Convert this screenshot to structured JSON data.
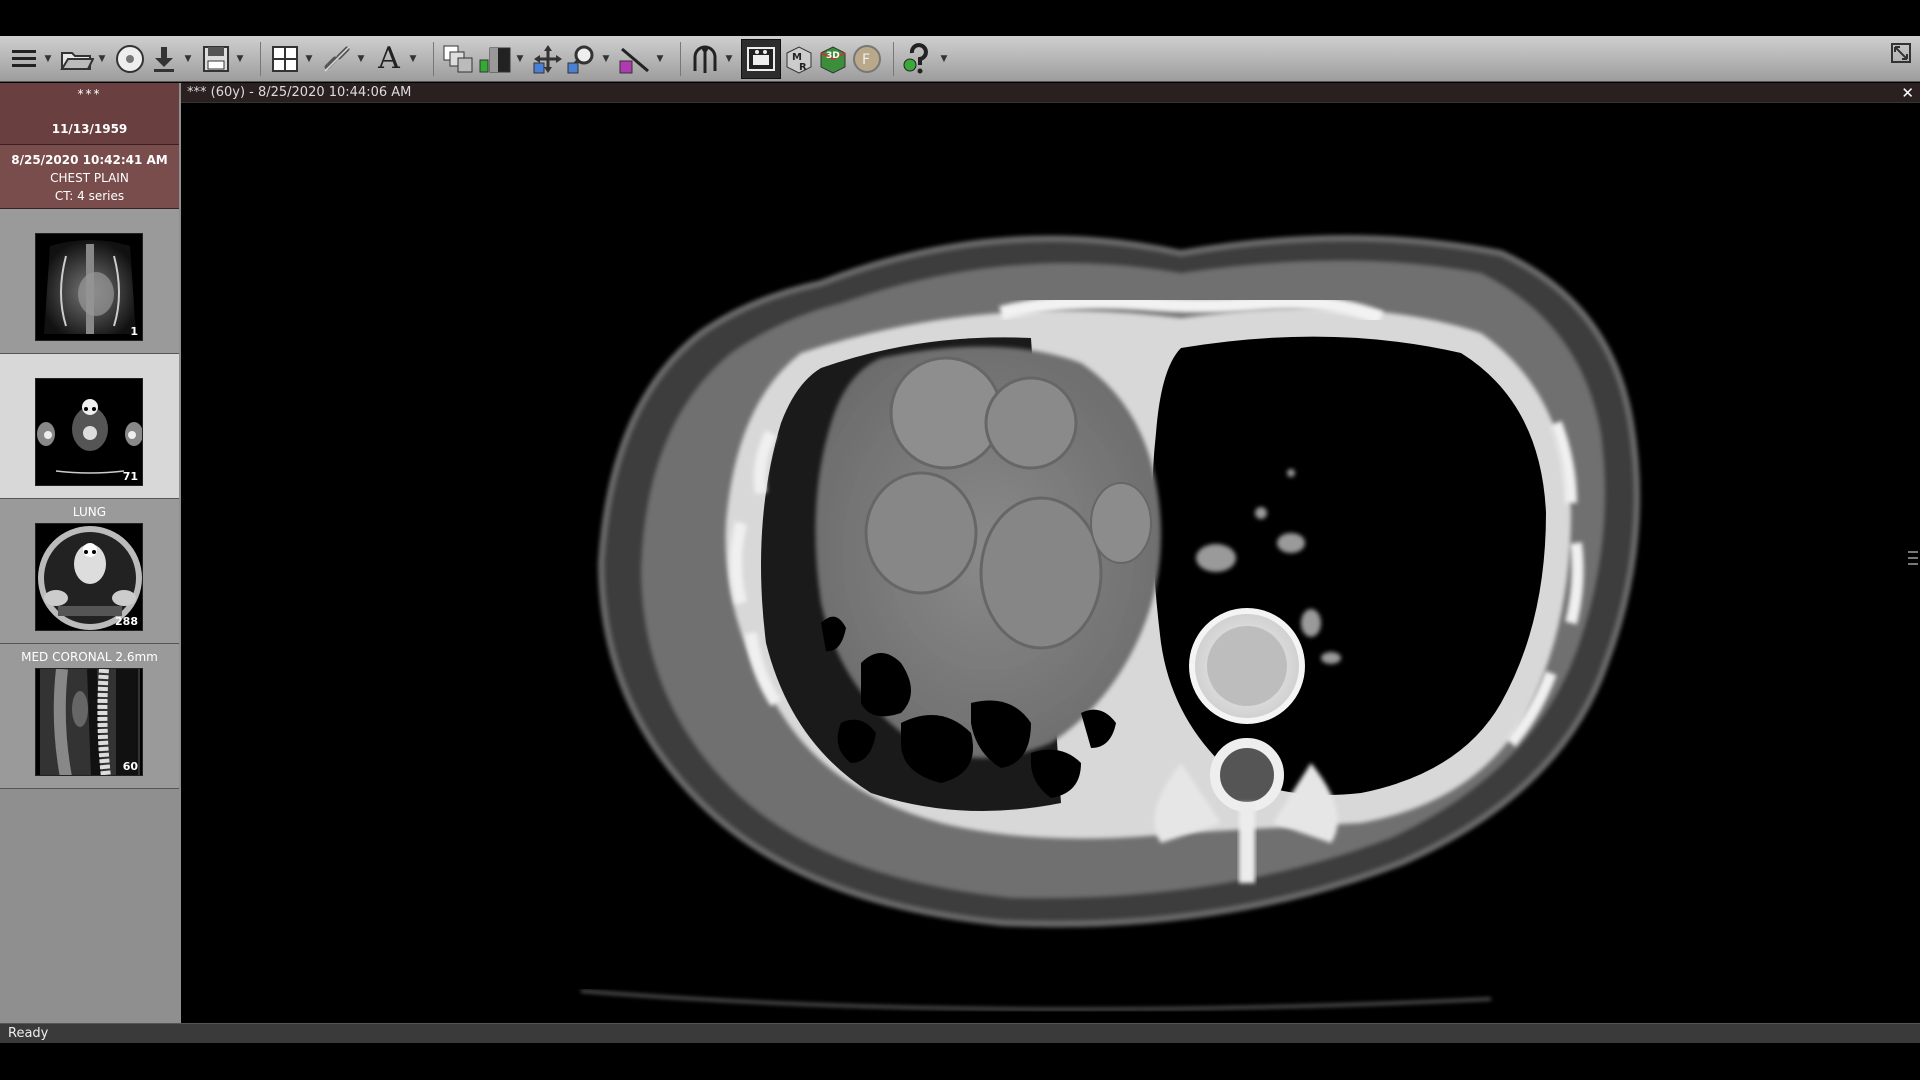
{
  "patient": {
    "name": "***",
    "dob": "11/13/1959"
  },
  "study": {
    "datetime": "8/25/2020 10:42:41 AM",
    "description": "CHEST PLAIN",
    "modality_series": "CT: 4 series"
  },
  "series": [
    {
      "label": "",
      "count": "1",
      "selected": false,
      "kind": "scout"
    },
    {
      "label": "",
      "count": "71",
      "selected": true,
      "kind": "axial-soft"
    },
    {
      "label": "LUNG",
      "count": "288",
      "selected": false,
      "kind": "axial-lung"
    },
    {
      "label": "MED CORONAL 2.6mm",
      "count": "60",
      "selected": false,
      "kind": "sagittal"
    }
  ],
  "viewer": {
    "title": "*** (60y) - 8/25/2020 10:44:06 AM",
    "close_symbol": "✕"
  },
  "status": {
    "text": "Ready"
  },
  "toolbar": {
    "icons": [
      "menu-icon",
      "open-folder-icon",
      "cd-dvd-icon",
      "download-icon",
      "save-icon",
      "layout-grid-icon",
      "link-icon",
      "text-annotation-icon",
      "series-stack-icon",
      "window-level-icon",
      "pan-icon",
      "zoom-icon",
      "measure-icon",
      "probe-icon",
      "cine-icon",
      "mpr-icon",
      "3d-icon",
      "fusion-icon",
      "help-icon",
      "fullscreen-icon"
    ]
  },
  "colors": {
    "patient_header": "#6a3f40",
    "study_header": "#7a4d4d",
    "toolbar_top": "#cfcfcf",
    "panel": "#8f8f8f",
    "status": "#3a3a3a"
  }
}
